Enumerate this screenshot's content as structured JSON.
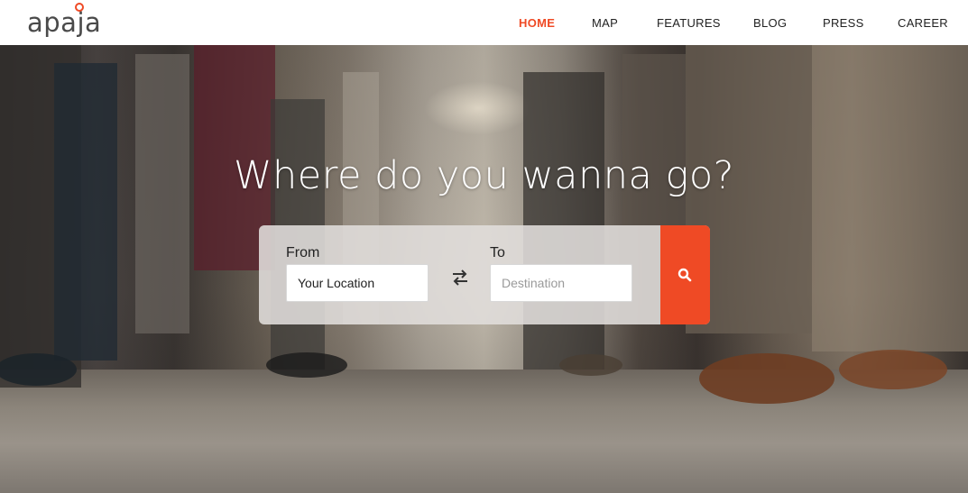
{
  "brand": {
    "logo_text": "apaja",
    "accent_color": "#ef4a25"
  },
  "nav": {
    "items": [
      {
        "label": "HOME",
        "active": true
      },
      {
        "label": "MAP",
        "active": false
      },
      {
        "label": "FEATURES",
        "active": false
      },
      {
        "label": "BLOG",
        "active": false
      },
      {
        "label": "PRESS",
        "active": false
      },
      {
        "label": "CAREER",
        "active": false
      }
    ]
  },
  "hero": {
    "headline": "Where do you wanna go?"
  },
  "search": {
    "from_label": "From",
    "from_value": "Your Location",
    "to_label": "To",
    "to_placeholder": "Destination",
    "swap_icon": "swap-arrows-icon",
    "search_icon": "search-icon",
    "button_color": "#ef4a25"
  }
}
